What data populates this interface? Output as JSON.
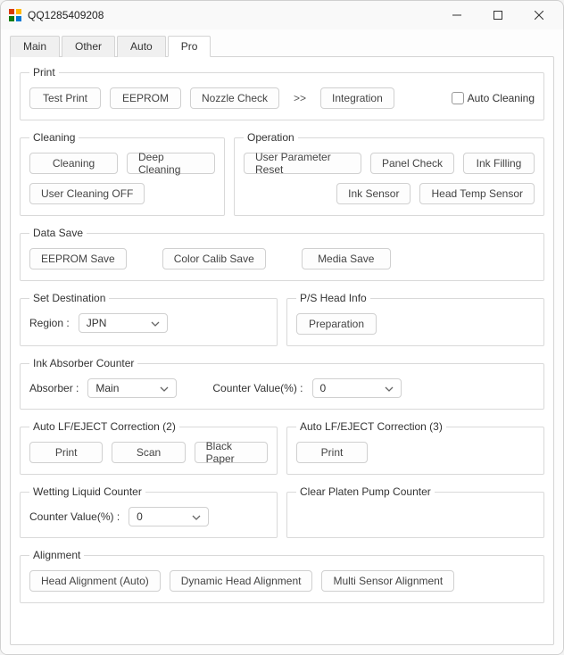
{
  "window": {
    "title": "QQ1285409208"
  },
  "tabs": {
    "items": [
      "Main",
      "Other",
      "Auto",
      "Pro"
    ],
    "active": "Pro"
  },
  "print": {
    "legend": "Print",
    "test_print": "Test Print",
    "eeprom": "EEPROM",
    "nozzle_check": "Nozzle Check",
    "sep": ">>",
    "integration": "Integration",
    "auto_cleaning": "Auto Cleaning"
  },
  "cleaning": {
    "legend": "Cleaning",
    "cleaning": "Cleaning",
    "deep_cleaning": "Deep Cleaning",
    "user_cleaning_off": "User Cleaning OFF"
  },
  "operation": {
    "legend": "Operation",
    "user_param_reset": "User Parameter Reset",
    "panel_check": "Panel Check",
    "ink_filling": "Ink Filling",
    "ink_sensor": "Ink Sensor",
    "head_temp_sensor": "Head Temp Sensor"
  },
  "data_save": {
    "legend": "Data Save",
    "eeprom_save": "EEPROM Save",
    "color_calib_save": "Color Calib Save",
    "media_save": "Media Save"
  },
  "set_destination": {
    "legend": "Set Destination",
    "region_label": "Region :",
    "region_value": "JPN"
  },
  "ps_head_info": {
    "legend": "P/S Head Info",
    "preparation": "Preparation"
  },
  "ink_absorber": {
    "legend": "Ink Absorber Counter",
    "absorber_label": "Absorber :",
    "absorber_value": "Main",
    "counter_label": "Counter Value(%) :",
    "counter_value": "0"
  },
  "auto_lf2": {
    "legend": "Auto LF/EJECT Correction (2)",
    "print": "Print",
    "scan": "Scan",
    "black_paper": "Black Paper"
  },
  "auto_lf3": {
    "legend": "Auto LF/EJECT Correction (3)",
    "print": "Print"
  },
  "wetting": {
    "legend": "Wetting Liquid Counter",
    "counter_label": "Counter Value(%) :",
    "counter_value": "0"
  },
  "clear_platen": {
    "legend": "Clear Platen Pump Counter"
  },
  "alignment": {
    "legend": "Alignment",
    "head_auto": "Head Alignment (Auto)",
    "dynamic": "Dynamic Head Alignment",
    "multi_sensor": "Multi Sensor Alignment"
  }
}
